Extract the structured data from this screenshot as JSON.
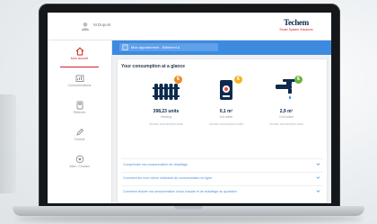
{
  "header": {
    "user_name": "M.Dupont",
    "brand_name": "Techem",
    "brand_tagline": "Smart System Solutions"
  },
  "sidebar": {
    "items": [
      {
        "label": "Mon accueil",
        "icon": "home-icon",
        "active": true
      },
      {
        "label": "Consommations",
        "icon": "chart-icon",
        "active": false
      },
      {
        "label": "Relevés",
        "icon": "meter-icon",
        "active": false
      },
      {
        "label": "Contrat",
        "icon": "pen-icon",
        "active": false
      },
      {
        "label": "Aide / Contact",
        "icon": "help-icon",
        "active": false
      }
    ]
  },
  "selector": {
    "label": "Mon appartement - Bâtiment A"
  },
  "main": {
    "title": "Your consumption at a glance",
    "cards": [
      {
        "value": "398,23 units",
        "unit": "Heating",
        "link": "Access consumption data",
        "icon": "radiator-icon",
        "badge": "€",
        "badge_color": "#f08a24"
      },
      {
        "value": "0,1 m³",
        "unit": "Hot water",
        "link": "Access consumption data",
        "icon": "hot-water-meter-icon",
        "badge": "€",
        "badge_color": "#f2b51c"
      },
      {
        "value": "2,9 m³",
        "unit": "Cold water",
        "link": "Access consumption data",
        "icon": "cold-water-tap-icon",
        "badge": "€",
        "badge_color": "#6ab33e"
      }
    ],
    "rows": [
      "Comprendre ma consommation de chauffage",
      "Comment lire mon relevé individuel de consommation en ligne",
      "Comment réduire ma consommation d'eau chaude et de chauffage au quotidien"
    ]
  },
  "colors": {
    "accent_red": "#d11f26",
    "accent_blue": "#3d8be0",
    "brand_navy": "#0d2a4d"
  }
}
